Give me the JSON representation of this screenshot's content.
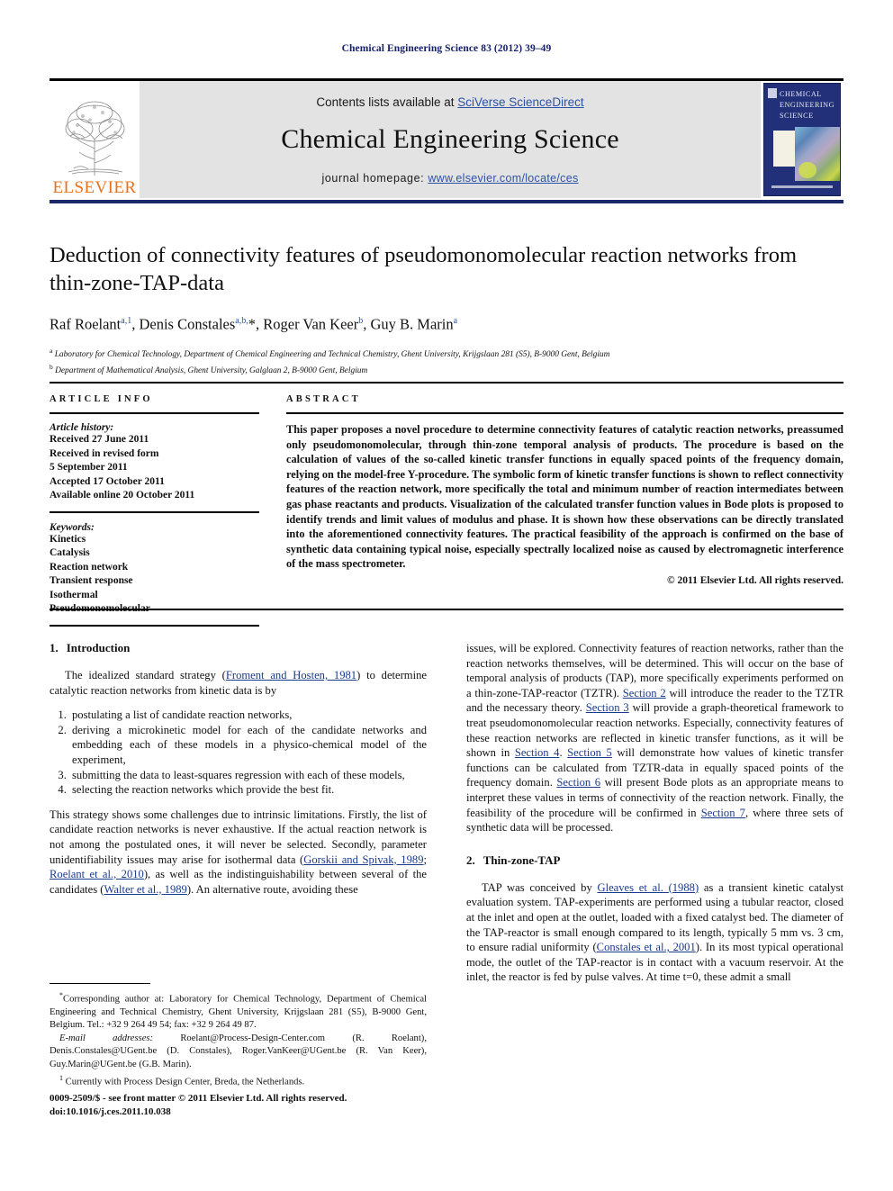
{
  "running_head": "Chemical Engineering Science 83 (2012) 39–49",
  "masthead": {
    "elsevier_wordmark": "ELSEVIER",
    "contents_prefix": "Contents lists available at ",
    "contents_link": "SciVerse ScienceDirect",
    "journal_title": "Chemical Engineering Science",
    "homepage_prefix": "journal homepage: ",
    "homepage_link": "www.elsevier.com/locate/ces",
    "cover_title": "CHEMICAL ENGINEERING SCIENCE"
  },
  "title_block": {
    "title": "Deduction of connectivity features of pseudomonomolecular reaction networks from thin-zone-TAP-data",
    "authors_html": "Raf Roelant<sup>a,1</sup>, Denis Constales<sup>a,b,</sup>*, Roger Van Keer<sup>b</sup>, Guy B. Marin<sup>a</sup>",
    "affiliation_a": "Laboratory for Chemical Technology, Department of Chemical Engineering and Technical Chemistry, Ghent University, Krijgslaan 281 (S5), B-9000 Gent, Belgium",
    "affiliation_b": "Department of Mathematical Analysis, Ghent University, Galglaan 2, B-9000 Gent, Belgium"
  },
  "article_info": {
    "kicker": "ARTICLE INFO",
    "history_label": "Article history:",
    "history_lines": [
      "Received 27 June 2011",
      "Received in revised form",
      "5 September 2011",
      "Accepted 17 October 2011",
      "Available online 20 October 2011"
    ],
    "keywords_label": "Keywords:",
    "keywords": [
      "Kinetics",
      "Catalysis",
      "Reaction network",
      "Transient response",
      "Isothermal",
      "Pseudomonomolecular"
    ]
  },
  "abstract": {
    "kicker": "ABSTRACT",
    "text": "This paper proposes a novel procedure to determine connectivity features of catalytic reaction networks, preassumed only pseudomonomolecular, through thin-zone temporal analysis of products. The procedure is based on the calculation of values of the so-called kinetic transfer functions in equally spaced points of the frequency domain, relying on the model-free Y-procedure. The symbolic form of kinetic transfer functions is shown to reflect connectivity features of the reaction network, more specifically the total and minimum number of reaction intermediates between gas phase reactants and products. Visualization of the calculated transfer function values in Bode plots is proposed to identify trends and limit values of modulus and phase. It is shown how these observations can be directly translated into the aforementioned connectivity features. The practical feasibility of the approach is confirmed on the base of synthetic data containing typical noise, especially spectrally localized noise as caused by electromagnetic interference of the mass spectrometer.",
    "copyright": "© 2011 Elsevier Ltd. All rights reserved."
  },
  "body": {
    "intro_heading_num": "1.",
    "intro_heading_text": "Introduction",
    "intro_p1_a": "The idealized standard strategy (",
    "intro_p1_ref": "Froment and Hosten, 1981",
    "intro_p1_b": ") to determine catalytic reaction networks from kinetic data is by",
    "numbered_items": [
      "postulating a list of candidate reaction networks,",
      "deriving a microkinetic model for each of the candidate networks and embedding each of these models in a physico-chemical model of the experiment,",
      "submitting the data to least-squares regression with each of these models,",
      "selecting the reaction networks which provide the best fit."
    ],
    "intro_p2_a": "This strategy shows some challenges due to intrinsic limitations. Firstly, the list of candidate reaction networks is never exhaustive. If the actual reaction network is not among the postulated ones, it will never be selected. Secondly, parameter unidentifiability issues may arise for isothermal data (",
    "intro_p2_ref1": "Gorskii and Spivak, 1989",
    "intro_p2_b": "; ",
    "intro_p2_ref2": "Roelant et al., 2010",
    "intro_p2_c": "), as well as the indistinguishability between several of the candidates (",
    "intro_p2_ref3": "Walter et al., 1989",
    "intro_p2_d": "). An alternative route, avoiding these",
    "right_p1_a": "issues, will be explored. Connectivity features of reaction networks, rather than the reaction networks themselves, will be determined. This will occur on the base of temporal analysis of products (TAP), more specifically experiments performed on a thin-zone-TAP-reactor (TZTR). ",
    "right_p1_ref1": "Section 2",
    "right_p1_b": " will introduce the reader to the TZTR and the necessary theory. ",
    "right_p1_ref2": "Section 3",
    "right_p1_c": " will provide a graph-theoretical framework to treat pseudomonomolecular reaction networks. Especially, connectivity features of these reaction networks are reflected in kinetic transfer functions, as it will be shown in ",
    "right_p1_ref3": "Section 4",
    "right_p1_d": ". ",
    "right_p1_ref4": "Section 5",
    "right_p1_e": " will demonstrate how values of kinetic transfer functions can be calculated from TZTR-data in equally spaced points of the frequency domain. ",
    "right_p1_ref5": "Section 6",
    "right_p1_f": " will present Bode plots as an appropriate means to interpret these values in terms of connectivity of the reaction network. Finally, the feasibility of the procedure will be confirmed in ",
    "right_p1_ref6": "Section 7",
    "right_p1_g": ", where three sets of synthetic data will be processed.",
    "sec2_heading_num": "2.",
    "sec2_heading_text": "Thin-zone-TAP",
    "sec2_p1_a": "TAP was conceived by ",
    "sec2_p1_ref1": "Gleaves et al. (1988)",
    "sec2_p1_b": " as a transient kinetic catalyst evaluation system. TAP-experiments are performed using a tubular reactor, closed at the inlet and open at the outlet, loaded with a fixed catalyst bed. The diameter of the TAP-reactor is small enough compared to its length, typically 5 mm vs. 3 cm, to ensure radial uniformity (",
    "sec2_p1_ref2": "Constales et al., 2001",
    "sec2_p1_c": "). In its most typical operational mode, the outlet of the TAP-reactor is in contact with a vacuum reservoir. At the inlet, the reactor is fed by pulse valves. At time t=0, these admit a small"
  },
  "footnotes": {
    "corresponding_marker": "*",
    "corresponding": "Corresponding author at: Laboratory for Chemical Technology, Department of Chemical Engineering and Technical Chemistry, Ghent University, Krijgslaan 281 (S5), B-9000 Gent, Belgium. Tel.: +32 9 264 49 54; fax: +32 9 264 49 87.",
    "email_label": "E-mail addresses:",
    "emails": "Roelant@Process-Design-Center.com (R. Roelant), Denis.Constales@UGent.be (D. Constales), Roger.VanKeer@UGent.be (R. Van Keer), Guy.Marin@UGent.be (G.B. Marin).",
    "note1_marker": "1",
    "note1": "Currently with Process Design Center, Breda, the Netherlands."
  },
  "issn": {
    "line1": "0009-2509/$ - see front matter © 2011 Elsevier Ltd. All rights reserved.",
    "line2": "doi:10.1016/j.ces.2011.10.038"
  },
  "colors": {
    "link_blue": "#2c53a5",
    "ref_blue": "#1b3a8c",
    "running_head_blue": "#16216b",
    "elsevier_orange": "#E9711C",
    "masthead_gray": "#e3e3e3",
    "cover_navy": "#22307a"
  }
}
